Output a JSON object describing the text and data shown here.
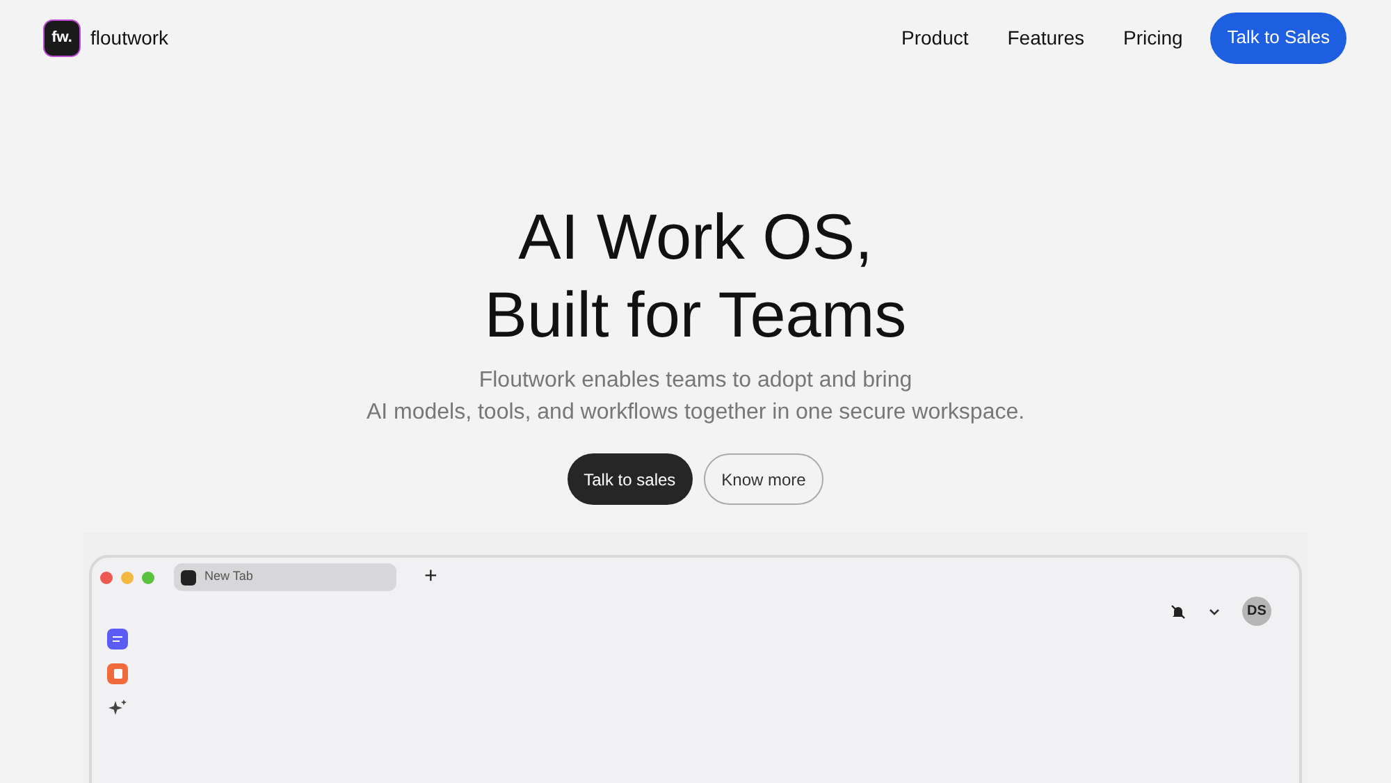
{
  "brand": {
    "logo": "fw.",
    "name": "floutwork"
  },
  "nav": {
    "links": [
      "Product",
      "Features",
      "Pricing"
    ],
    "cta": "Talk to Sales"
  },
  "hero": {
    "title_lines": [
      "AI Work OS,",
      "Built for Teams"
    ],
    "subtitle_lines": [
      "Floutwork enables teams to adopt and bring",
      "AI models, tools, and workflows together in one secure workspace."
    ],
    "buttons": [
      {
        "label": "Talk to sales",
        "kind": "primary"
      },
      {
        "label": "Know more",
        "kind": "secondary"
      }
    ]
  },
  "app": {
    "tab": {
      "title": "New Tab"
    },
    "new_tab": "+",
    "avatar": "DS",
    "sidebar": [
      {
        "kind": "tasks",
        "color": "#5b5bf5"
      },
      {
        "kind": "doc",
        "color": "#f06a3c"
      },
      {
        "kind": "sparkle"
      }
    ]
  }
}
